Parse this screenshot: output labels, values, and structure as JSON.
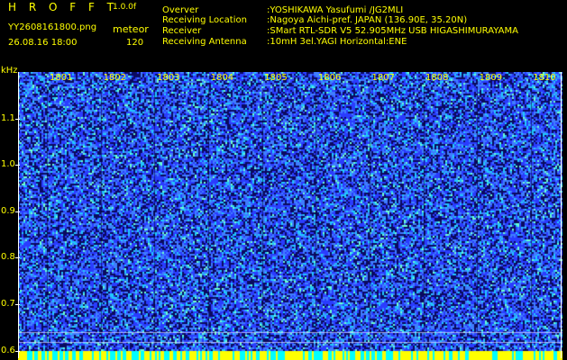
{
  "header": {
    "app_title": "H R O F F T",
    "app_version": "1.0.0f",
    "filename": "YY2608161800.png",
    "datetime": "26.08.16 18:00",
    "mode_label": "meteor",
    "mode_value": "120"
  },
  "info": [
    {
      "key": "Overver",
      "value": ":YOSHIKAWA Yasufumi /JG2MLI"
    },
    {
      "key": "Receiving Location",
      "value": ":Nagoya Aichi-pref. JAPAN (136.90E, 35.20N)"
    },
    {
      "key": "Receiver",
      "value": ":SMart RTL-SDR V5 52.905MHz USB HIGASHIMURAYAMA"
    },
    {
      "key": "Receiving Antenna",
      "value": ":10mH 3el.YAGI Horizontal:ENE"
    }
  ],
  "spectrogram": {
    "y_unit": "kHz",
    "y_ticks": [
      "1.1",
      "1.0",
      "0.9",
      "0.8",
      "0.7",
      "0.6"
    ],
    "y_tick_values": [
      1.1,
      1.0,
      0.9,
      0.8,
      0.7,
      0.6
    ],
    "y_range": [
      0.58,
      1.2
    ],
    "x_ticks": [
      "1801",
      "1802",
      "1803",
      "1804",
      "1805",
      "1806",
      "1807",
      "1808",
      "1809",
      "1810"
    ],
    "background_color": "#1a1ab4",
    "noise_colors": [
      "#2a3cff",
      "#3f7dff",
      "#20c8ff",
      "#6cffd0",
      "#0a0a60"
    ],
    "bottom_band_colors": [
      "#ffff00",
      "#00ffff"
    ]
  }
}
